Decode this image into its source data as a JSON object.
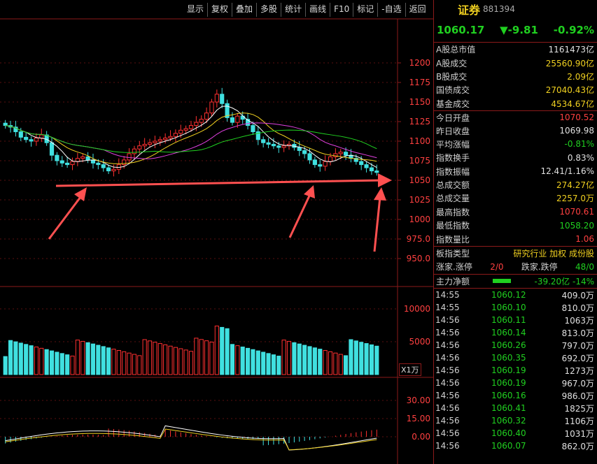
{
  "toolbar": [
    "显示",
    "复权",
    "叠加",
    "多股",
    "统计",
    "画线",
    "F10",
    "标记",
    "-自选",
    "返回"
  ],
  "index": {
    "name": "证券",
    "code": "881394",
    "price": "1060.17",
    "change": "▼-9.81",
    "pct": "-0.92%"
  },
  "stats": [
    {
      "k": "A股总市值",
      "v": "1161473亿",
      "c": "white"
    },
    {
      "k": "A股成交",
      "v": "25560.90亿",
      "c": "yellow"
    },
    {
      "k": "B股成交",
      "v": "2.09亿",
      "c": "yellow"
    },
    {
      "k": "国债成交",
      "v": "27040.43亿",
      "c": "yellow"
    },
    {
      "k": "基金成交",
      "v": "4534.67亿",
      "c": "yellow"
    },
    {
      "k": "今日开盘",
      "v": "1070.52",
      "c": "red"
    },
    {
      "k": "昨日收盘",
      "v": "1069.98",
      "c": "white"
    },
    {
      "k": "平均涨幅",
      "v": "-0.81%",
      "c": "green"
    },
    {
      "k": "指数换手",
      "v": "0.83%",
      "c": "white"
    },
    {
      "k": "指数振幅",
      "v": "12.41/1.16%",
      "c": "white"
    },
    {
      "k": "总成交额",
      "v": "274.27亿",
      "c": "yellow"
    },
    {
      "k": "总成交量",
      "v": "2257.0万",
      "c": "yellow"
    },
    {
      "k": "最高指数",
      "v": "1070.61",
      "c": "red"
    },
    {
      "k": "最低指数",
      "v": "1058.20",
      "c": "green"
    },
    {
      "k": "指数量比",
      "v": "1.06",
      "c": "red"
    }
  ],
  "board": {
    "label": "板指类型",
    "value": "研究行业 加权 成份股"
  },
  "breadth": {
    "label1": "涨家.涨停",
    "val1": "2/0",
    "label2": "跌家.跌停",
    "val2": "48/0"
  },
  "flow": {
    "label": "主力净额",
    "value": "-39.20亿 -14%"
  },
  "ticks": [
    {
      "t": "14:55",
      "p": "1060.12",
      "v": "409.0万"
    },
    {
      "t": "14:55",
      "p": "1060.10",
      "v": "810.0万"
    },
    {
      "t": "14:56",
      "p": "1060.11",
      "v": "1063万"
    },
    {
      "t": "14:56",
      "p": "1060.14",
      "v": "813.0万"
    },
    {
      "t": "14:56",
      "p": "1060.26",
      "v": "797.0万"
    },
    {
      "t": "14:56",
      "p": "1060.35",
      "v": "692.0万"
    },
    {
      "t": "14:56",
      "p": "1060.19",
      "v": "1273万"
    },
    {
      "t": "14:56",
      "p": "1060.19",
      "v": "967.0万"
    },
    {
      "t": "14:56",
      "p": "1060.16",
      "v": "986.0万"
    },
    {
      "t": "14:56",
      "p": "1060.41",
      "v": "1825万"
    },
    {
      "t": "14:56",
      "p": "1060.32",
      "v": "1106万"
    },
    {
      "t": "14:56",
      "p": "1060.40",
      "v": "1031万"
    },
    {
      "t": "14:56",
      "p": "1060.07",
      "v": "862.0万"
    }
  ],
  "price_axis": [
    "1200",
    "1175",
    "1150",
    "1125",
    "1100",
    "1075",
    "1050",
    "1025",
    "1000",
    "975.0",
    "950.0"
  ],
  "volume_axis": [
    "10000",
    "5000"
  ],
  "volume_unit": "X1万",
  "macd_axis": [
    "30.00",
    "15.00",
    "0.00"
  ],
  "chart_data": {
    "type": "candlestick",
    "price_range": [
      950,
      1200
    ],
    "closes": [
      1120,
      1118,
      1112,
      1105,
      1102,
      1100,
      1104,
      1108,
      1098,
      1082,
      1075,
      1072,
      1070,
      1074,
      1078,
      1080,
      1076,
      1072,
      1070,
      1066,
      1062,
      1064,
      1070,
      1076,
      1084,
      1090,
      1094,
      1096,
      1098,
      1100,
      1102,
      1104,
      1106,
      1110,
      1114,
      1116,
      1120,
      1124,
      1128,
      1136,
      1150,
      1160,
      1148,
      1130,
      1124,
      1132,
      1128,
      1120,
      1112,
      1102,
      1098,
      1096,
      1094,
      1092,
      1094,
      1096,
      1092,
      1088,
      1084,
      1076,
      1070,
      1068,
      1074,
      1080,
      1084,
      1086,
      1082,
      1078,
      1074,
      1070,
      1066,
      1062,
      1060
    ],
    "volume_range": [
      0,
      12000
    ],
    "macd_range": [
      -10,
      38
    ]
  }
}
